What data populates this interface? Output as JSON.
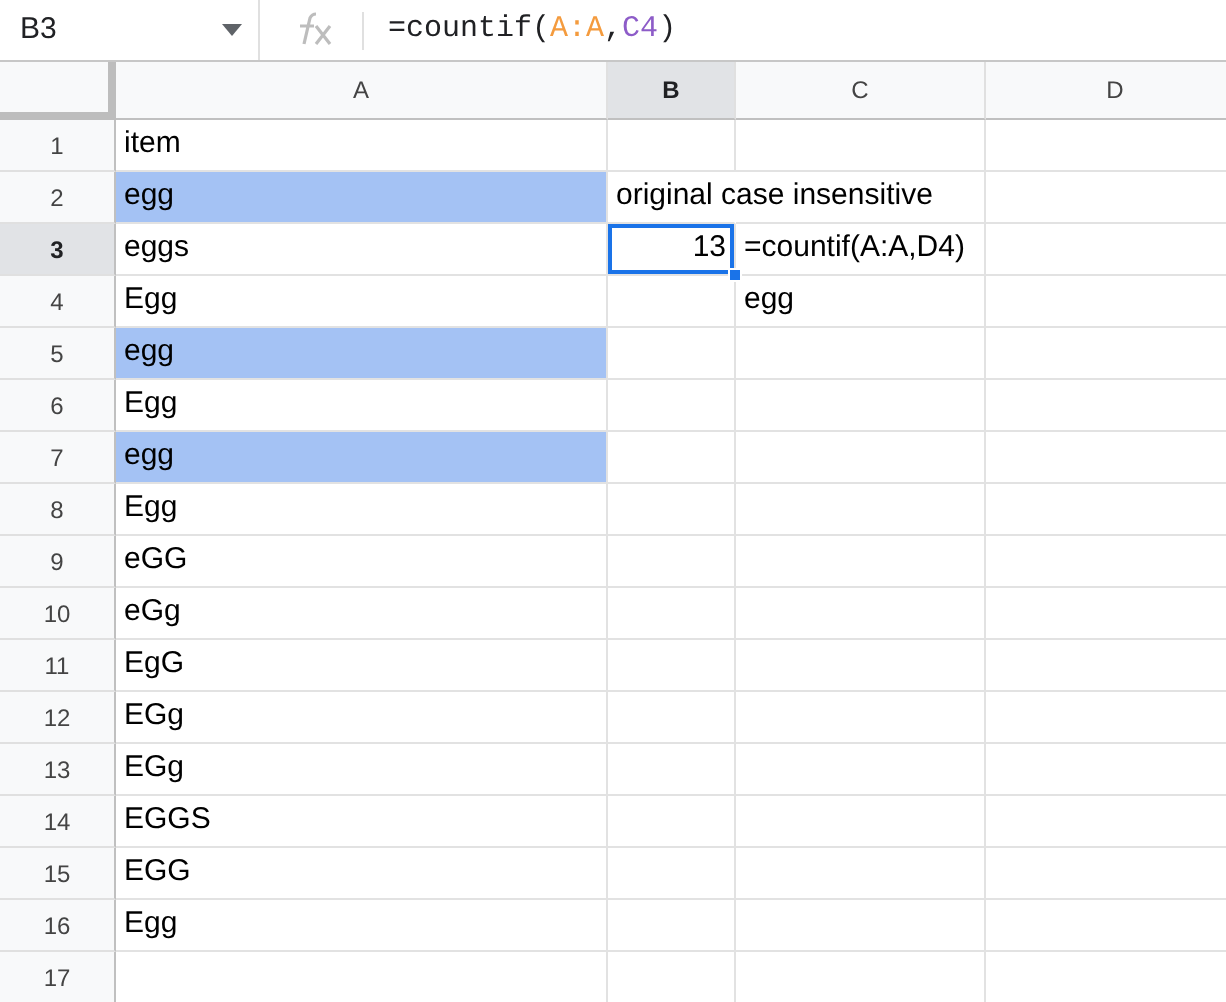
{
  "name_box": "B3",
  "formula": [
    {
      "text": "=countif(",
      "color": "#202124"
    },
    {
      "text": "A:A",
      "color": "#f49b3e"
    },
    {
      "text": ",",
      "color": "#202124"
    },
    {
      "text": "C4",
      "color": "#8d5cc8"
    },
    {
      "text": ")",
      "color": "#202124"
    }
  ],
  "columns": [
    {
      "label": "A",
      "selected": false
    },
    {
      "label": "B",
      "selected": true
    },
    {
      "label": "C",
      "selected": false
    },
    {
      "label": "D",
      "selected": false
    }
  ],
  "rows": [
    {
      "label": "1",
      "selected": false,
      "cells": [
        {
          "text": "item",
          "highlighted": false
        },
        {},
        {},
        {}
      ]
    },
    {
      "label": "2",
      "selected": false,
      "cells": [
        {
          "text": "egg",
          "highlighted": true
        },
        {
          "text": "original case insensitive"
        },
        {},
        {}
      ]
    },
    {
      "label": "3",
      "selected": true,
      "cells": [
        {
          "text": "eggs",
          "highlighted": false
        },
        {
          "text": "13",
          "kind": "number",
          "selected": true
        },
        {
          "text": "=countif(A:A,D4)"
        },
        {}
      ]
    },
    {
      "label": "4",
      "selected": false,
      "cells": [
        {
          "text": "Egg",
          "highlighted": false
        },
        {},
        {
          "text": "egg"
        },
        {}
      ]
    },
    {
      "label": "5",
      "selected": false,
      "cells": [
        {
          "text": "egg",
          "highlighted": true
        },
        {},
        {},
        {}
      ]
    },
    {
      "label": "6",
      "selected": false,
      "cells": [
        {
          "text": "Egg",
          "highlighted": false
        },
        {},
        {},
        {}
      ]
    },
    {
      "label": "7",
      "selected": false,
      "cells": [
        {
          "text": "egg",
          "highlighted": true
        },
        {},
        {},
        {}
      ]
    },
    {
      "label": "8",
      "selected": false,
      "cells": [
        {
          "text": "Egg",
          "highlighted": false
        },
        {},
        {},
        {}
      ]
    },
    {
      "label": "9",
      "selected": false,
      "cells": [
        {
          "text": "eGG",
          "highlighted": false
        },
        {},
        {},
        {}
      ]
    },
    {
      "label": "10",
      "selected": false,
      "cells": [
        {
          "text": "eGg",
          "highlighted": false
        },
        {},
        {},
        {}
      ]
    },
    {
      "label": "11",
      "selected": false,
      "cells": [
        {
          "text": "EgG",
          "highlighted": false
        },
        {},
        {},
        {}
      ]
    },
    {
      "label": "12",
      "selected": false,
      "cells": [
        {
          "text": "EGg",
          "highlighted": false
        },
        {},
        {},
        {}
      ]
    },
    {
      "label": "13",
      "selected": false,
      "cells": [
        {
          "text": "EGg",
          "highlighted": false
        },
        {},
        {},
        {}
      ]
    },
    {
      "label": "14",
      "selected": false,
      "cells": [
        {
          "text": "EGGS",
          "highlighted": false
        },
        {},
        {},
        {}
      ]
    },
    {
      "label": "15",
      "selected": false,
      "cells": [
        {
          "text": "EGG",
          "highlighted": false
        },
        {},
        {},
        {}
      ]
    },
    {
      "label": "16",
      "selected": false,
      "cells": [
        {
          "text": "Egg",
          "highlighted": false
        },
        {},
        {},
        {}
      ]
    },
    {
      "label": "17",
      "selected": false,
      "cells": [
        {},
        {},
        {},
        {}
      ]
    }
  ]
}
